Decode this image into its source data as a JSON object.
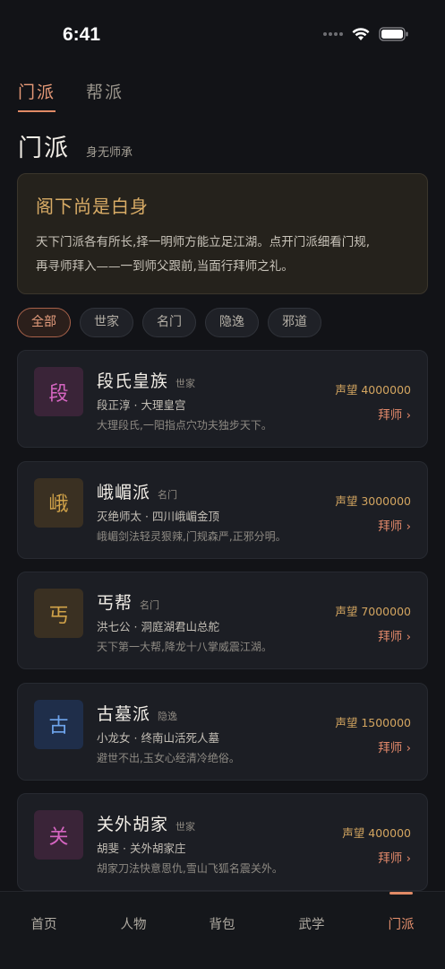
{
  "status_bar": {
    "time": "6:41"
  },
  "tabs": [
    {
      "label": "门派",
      "active": true
    },
    {
      "label": "帮派",
      "active": false
    }
  ],
  "header": {
    "title": "门派",
    "subtitle": "身无师承"
  },
  "notice": {
    "title": "阁下尚是白身",
    "text_line1": "天下门派各有所长,择一明师方能立足江湖。点开门派细看门规,",
    "text_line2": "再寻师拜入——一到师父跟前,当面行拜师之礼。"
  },
  "filters": [
    "全部",
    "世家",
    "名门",
    "隐逸",
    "邪道"
  ],
  "active_filter": "全部",
  "sects": [
    {
      "avatar": "段",
      "name": "段氏皇族",
      "category": "世家",
      "master": "段正淳",
      "location": "大理皇宫",
      "description": "大理段氏,一阳指点穴功夫独步天下。",
      "prestige": "声望 4000000",
      "join": "拜师 ›",
      "avatar_bg": "#3a2438",
      "avatar_color": "#d565c1"
    },
    {
      "avatar": "峨",
      "name": "峨嵋派",
      "category": "名门",
      "master": "灭绝师太",
      "location": "四川峨嵋金顶",
      "description": "峨嵋剑法轻灵狠辣,门规森严,正邪分明。",
      "prestige": "声望 3000000",
      "join": "拜师 ›",
      "avatar_bg": "#3a3022",
      "avatar_color": "#d2a349"
    },
    {
      "avatar": "丐",
      "name": "丐帮",
      "category": "名门",
      "master": "洪七公",
      "location": "洞庭湖君山总舵",
      "description": "天下第一大帮,降龙十八掌威震江湖。",
      "prestige": "声望 7000000",
      "join": "拜师 ›",
      "avatar_bg": "#3a3022",
      "avatar_color": "#d2a349"
    },
    {
      "avatar": "古",
      "name": "古墓派",
      "category": "隐逸",
      "master": "小龙女",
      "location": "终南山活死人墓",
      "description": "避世不出,玉女心经清冷绝俗。",
      "prestige": "声望 1500000",
      "join": "拜师 ›",
      "avatar_bg": "#1f2e4a",
      "avatar_color": "#6ea4ec"
    },
    {
      "avatar": "关",
      "name": "关外胡家",
      "category": "世家",
      "master": "胡斐",
      "location": "关外胡家庄",
      "description": "胡家刀法快意恩仇,雪山飞狐名震关外。",
      "prestige": "声望 400000",
      "join": "拜师 ›",
      "avatar_bg": "#3a2438",
      "avatar_color": "#d565c1"
    }
  ],
  "bottom_nav": [
    {
      "label": "首页",
      "active": false
    },
    {
      "label": "人物",
      "active": false
    },
    {
      "label": "背包",
      "active": false
    },
    {
      "label": "武学",
      "active": false
    },
    {
      "label": "门派",
      "active": true
    }
  ],
  "colors": {
    "accent": "#e08a66",
    "gold": "#d3a560",
    "background": "#121317"
  }
}
